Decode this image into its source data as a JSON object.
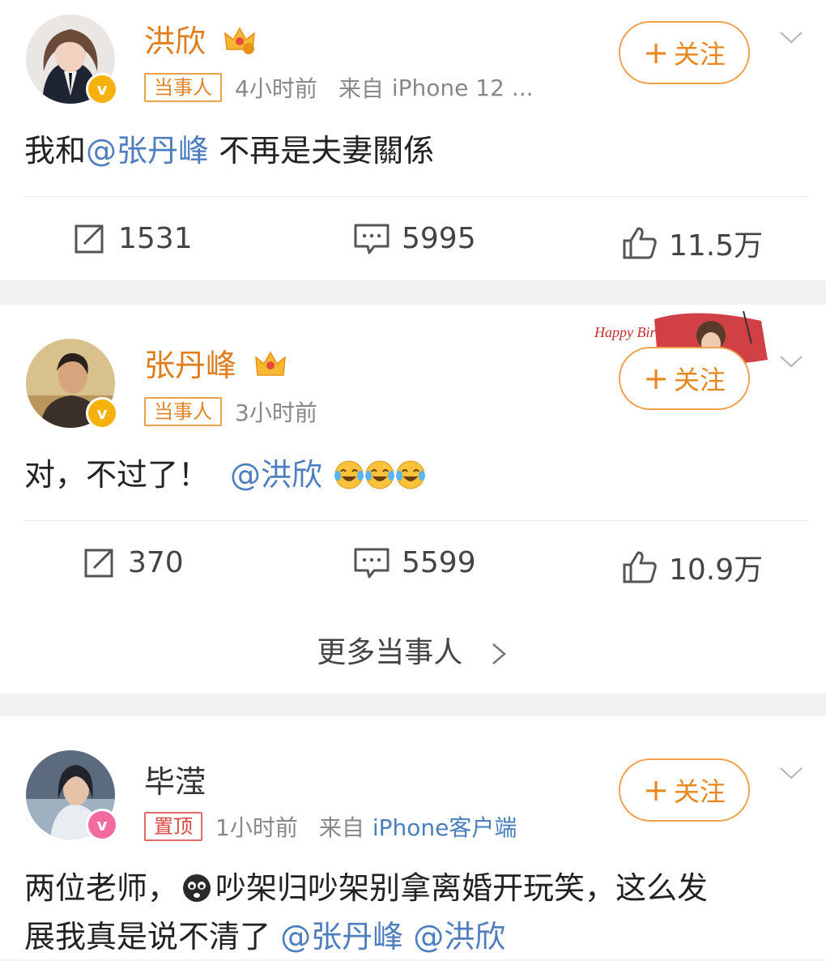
{
  "colors": {
    "accent_orange": "#e8861e",
    "link_blue": "#4f7ec0",
    "verified_yellow": "#f6b20a",
    "vip_pink": "#f36aa1"
  },
  "posts": [
    {
      "name": "洪欣",
      "tag": "当事人",
      "time": "4小时前",
      "source_prefix": "来自",
      "source_device": "iPhone 12 ...",
      "follow_label": "关注",
      "text_before": "我和",
      "mention": "@张丹峰",
      "text_after": " 不再是夫妻關係",
      "reposts": "1531",
      "comments": "5995",
      "likes": "11.5万",
      "avatar_icon": "avatar-woman",
      "badge_icon": "verified-v"
    },
    {
      "name": "张丹峰",
      "tag": "当事人",
      "time": "3小时前",
      "follow_label": "关注",
      "text_before": "对，不过了！",
      "mention": "@洪欣",
      "emoji_icons": [
        "laugh-cry-emoji",
        "laugh-cry-emoji",
        "laugh-cry-emoji"
      ],
      "reposts": "370",
      "comments": "5599",
      "likes": "10.9万",
      "avatar_icon": "avatar-man",
      "badge_icon": "verified-v",
      "decoration_text": "Happy Bir"
    }
  ],
  "more_parties": "更多当事人",
  "post3": {
    "name": "毕滢",
    "tag": "置顶",
    "time": "1小时前",
    "source_prefix": "来自",
    "source_device": "iPhone客户端",
    "follow_label": "关注",
    "line1_a": "两位老师，",
    "line1_b": "吵架归吵架别拿离婚开玩笑，这么发",
    "line2_a": "展我真是说不清了 ",
    "mention1": "@张丹峰",
    "mention2": "@洪欣",
    "emoji_icon": "crying-face-emoji",
    "avatar_icon": "avatar-woman-2",
    "badge_icon": "vip-v"
  }
}
